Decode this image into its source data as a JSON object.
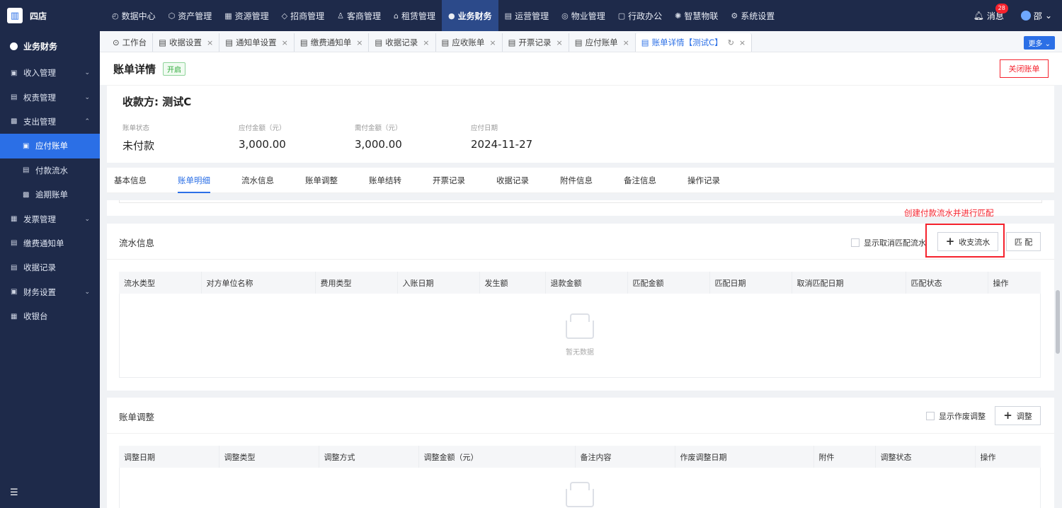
{
  "brand": {
    "name": "四店"
  },
  "topnav": [
    {
      "icon": "◴",
      "label": "数据中心"
    },
    {
      "icon": "⬡",
      "label": "资产管理"
    },
    {
      "icon": "▦",
      "label": "资源管理"
    },
    {
      "icon": "◇",
      "label": "招商管理"
    },
    {
      "icon": "♙",
      "label": "客商管理"
    },
    {
      "icon": "⌂",
      "label": "租赁管理"
    },
    {
      "icon": "●",
      "label": "业务财务"
    },
    {
      "icon": "▤",
      "label": "运营管理"
    },
    {
      "icon": "◎",
      "label": "物业管理"
    },
    {
      "icon": "▢",
      "label": "行政办公"
    },
    {
      "icon": "✺",
      "label": "智慧物联"
    },
    {
      "icon": "⚙",
      "label": "系统设置"
    }
  ],
  "top_right": {
    "messages_label": "消息",
    "messages_count": "28",
    "user": "邵"
  },
  "sidebar": {
    "header": "业务财务",
    "items": [
      {
        "icon": "▣",
        "label": "收入管理",
        "chev": "⌄"
      },
      {
        "icon": "▤",
        "label": "权责管理",
        "chev": "⌄"
      },
      {
        "icon": "▩",
        "label": "支出管理",
        "chev": "⌃"
      },
      {
        "icon": "▣",
        "label": "应付账单",
        "chev": ""
      },
      {
        "icon": "▤",
        "label": "付款流水",
        "chev": ""
      },
      {
        "icon": "▩",
        "label": "逾期账单",
        "chev": ""
      },
      {
        "icon": "▦",
        "label": "发票管理",
        "chev": "⌄"
      },
      {
        "icon": "▤",
        "label": "缴费通知单",
        "chev": ""
      },
      {
        "icon": "▤",
        "label": "收据记录",
        "chev": ""
      },
      {
        "icon": "▣",
        "label": "财务设置",
        "chev": "⌄"
      },
      {
        "icon": "▦",
        "label": "收银台",
        "chev": ""
      }
    ],
    "collapse_icon": "☰"
  },
  "tabs": [
    {
      "label": "工作台",
      "icon": "⊙",
      "close": ""
    },
    {
      "label": "收据设置",
      "icon": "▤",
      "close": "×"
    },
    {
      "label": "通知单设置",
      "icon": "▤",
      "close": "×"
    },
    {
      "label": "缴费通知单",
      "icon": "▤",
      "close": "×"
    },
    {
      "label": "收据记录",
      "icon": "▤",
      "close": "×"
    },
    {
      "label": "应收账单",
      "icon": "▤",
      "close": "×"
    },
    {
      "label": "开票记录",
      "icon": "▤",
      "close": "×"
    },
    {
      "label": "应付账单",
      "icon": "▤",
      "close": "×"
    },
    {
      "label": "账单详情【测试C】",
      "icon": "▤",
      "close": "×",
      "refresh": "↻"
    }
  ],
  "more_label": "更多 ⌄",
  "header": {
    "title": "账单详情",
    "status": "开启",
    "close_button": "关闭账单"
  },
  "summary": {
    "payee": "收款方: 测试C",
    "stats": [
      {
        "label": "账单状态",
        "value": "未付款"
      },
      {
        "label": "应付金额（元）",
        "value": "3,000.00"
      },
      {
        "label": "需付金额（元）",
        "value": "3,000.00"
      },
      {
        "label": "应付日期",
        "value": "2024-11-27"
      }
    ]
  },
  "detail_tabs": [
    "基本信息",
    "账单明细",
    "流水信息",
    "账单调整",
    "账单结转",
    "开票记录",
    "收据记录",
    "附件信息",
    "备注信息",
    "操作记录"
  ],
  "flow_panel": {
    "title": "流水信息",
    "checkbox_label": "显示取消匹配流水",
    "add_button": "收支流水",
    "match_button": "匹 配",
    "columns": [
      "流水类型",
      "对方单位名称",
      "费用类型",
      "入账日期",
      "发生额",
      "退款金额",
      "匹配金额",
      "匹配日期",
      "取消匹配日期",
      "匹配状态",
      "操作"
    ],
    "empty_text": "暂无数据"
  },
  "annotation": {
    "text": "创建付款流水并进行匹配",
    "color": "#f5222d"
  },
  "adjust_panel": {
    "title": "账单调整",
    "checkbox_label": "显示作废调整",
    "add_button": "调整",
    "columns": [
      "调整日期",
      "调整类型",
      "调整方式",
      "调整金额（元）",
      "备注内容",
      "作废调整日期",
      "附件",
      "调整状态",
      "操作"
    ]
  },
  "colors": {
    "primary": "#2b6fe6",
    "nav_bg": "#1e2a4a",
    "danger": "#f5222d",
    "success": "#2faa3a"
  }
}
